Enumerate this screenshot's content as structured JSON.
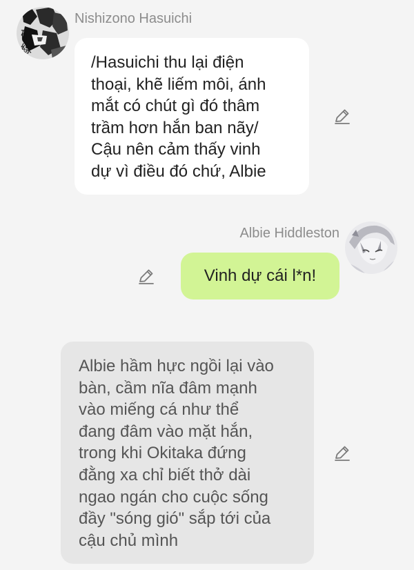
{
  "messages": [
    {
      "sender": "Nishizono Hasuichi",
      "avatar_icon": "avatar-nishizono",
      "side": "left",
      "lines": [
        "/Hasuichi thu lại điện",
        "thoại, khẽ liếm môi, ánh",
        "mắt có chút gì đó thâm",
        "trầm hơn hắn ban nãy/",
        "Cậu nên cảm thấy vinh",
        "dự vì điều đó chứ, Albie"
      ],
      "bubble_color": "#ffffff",
      "edit_icon": "pencil-icon"
    },
    {
      "sender": "Albie Hiddleston",
      "avatar_icon": "avatar-albie",
      "side": "right",
      "lines": [
        "Vinh dự cái l*n!"
      ],
      "bubble_color": "#d2f495",
      "edit_icon": "pencil-icon"
    },
    {
      "sender": "",
      "side": "narration",
      "lines": [
        "Albie hầm hực ngồi lại vào",
        "bàn, cầm nĩa đâm mạnh",
        "vào miếng cá như thể",
        "đang đâm vào mặt hắn,",
        "trong khi Okitaka đứng",
        "đằng xa chỉ biết thở dài",
        "ngao ngán cho cuộc sống",
        "đầy \"sóng gió\" sắp tới của",
        "cậu chủ mình"
      ],
      "bubble_color": "#e6e6e6",
      "edit_icon": "pencil-icon"
    }
  ],
  "colors": {
    "background": "#f4f4f4",
    "name_text": "#8c8c8c",
    "narration_text": "#555555"
  }
}
